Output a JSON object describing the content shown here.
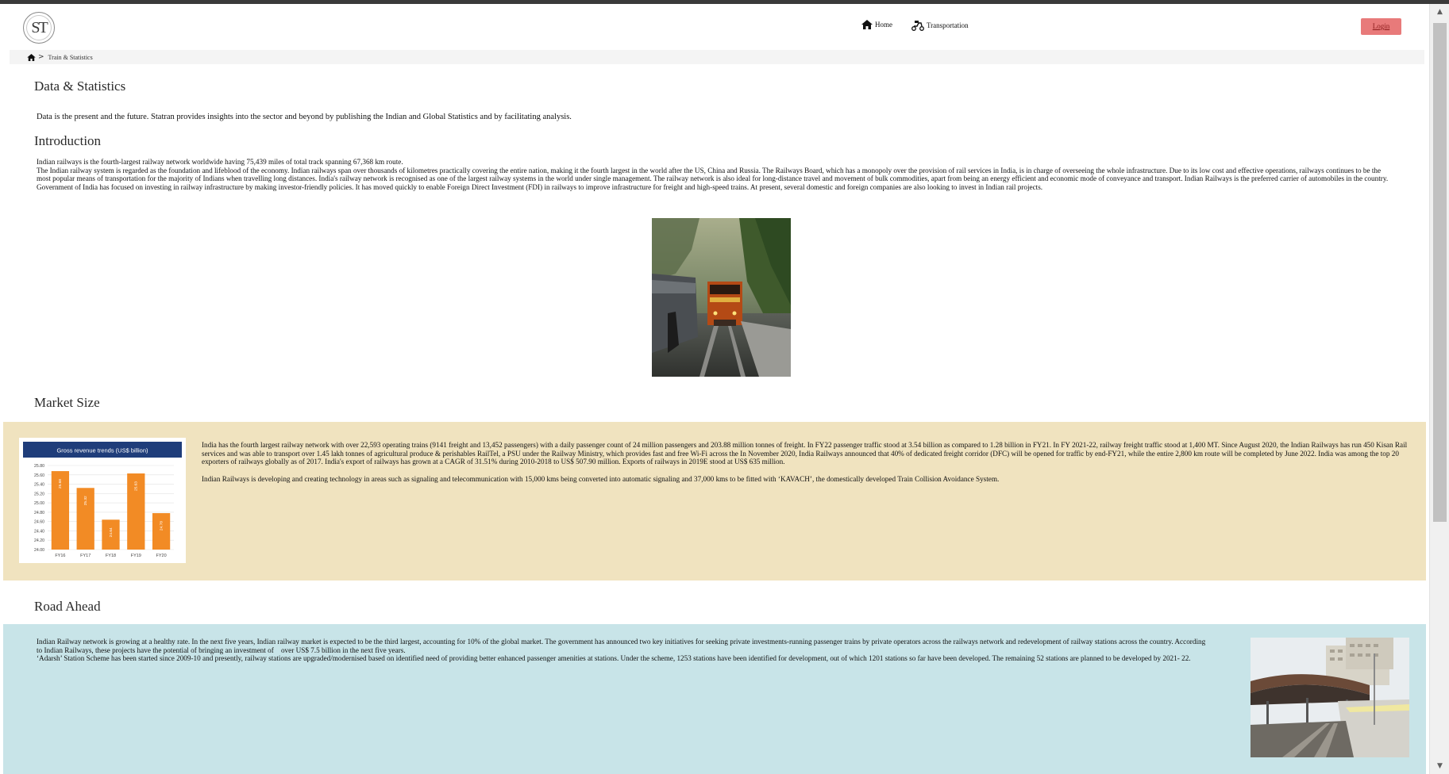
{
  "header": {
    "logo_text": "ST",
    "nav": [
      {
        "label": "Home",
        "icon": "home-icon"
      },
      {
        "label": "Transportation",
        "icon": "scooter-icon"
      }
    ],
    "login_label": "Login"
  },
  "breadcrumb": {
    "home_icon": "home-icon",
    "separator": ">",
    "current": "Train & Statistics"
  },
  "sections": {
    "data_stats": {
      "title": "Data & Statistics",
      "text": "Data is the present and the future. Statran provides insights into the sector and beyond by publishing the Indian and Global Statistics and by facilitating analysis."
    },
    "introduction": {
      "title": "Introduction",
      "line1": "Indian railways is the fourth-largest railway network worldwide having 75,439 miles of total track spanning 67,368 km route.",
      "line2": "The Indian railway system is regarded as the foundation and lifeblood of the economy. Indian railways span over thousands of kilometres practically covering the entire nation, making it the fourth largest in the world after the US, China and Russia. The Railways Board, which has a monopoly over the provision of rail services in India, is in charge of overseeing the whole infrastructure. Due to its low cost and effective operations, railways continues to be the most popular means of transportation for the majority of Indians when travelling long distances. India's railway network is recognised as one of the largest railway systems in the world under single management. The railway network is also ideal for long-distance travel and movement of bulk commodities, apart from being an energy efficient and economic mode of conveyance and transport. Indian Railways is the preferred carrier of automobiles in the country. Government of India has focused on investing in railway infrastructure by making investor-friendly policies. It has moved quickly to enable Foreign Direct Investment (FDI) in railways to improve infrastructure for freight and high-speed trains. At present, several domestic and foreign companies are also looking to invest in Indian rail projects."
    },
    "market_size": {
      "title": "Market Size",
      "para1": "India has the fourth largest railway network with over 22,593 operating trains (9141 freight and 13,452 passengers) with a daily passenger count of 24 million passengers and 203.88 million tonnes of freight. In FY22 passenger traffic stood at 3.54 billion as compared to 1.28 billion in FY21. In FY 2021-22, railway freight traffic stood at 1,400 MT. Since August 2020, the Indian Railways has run 450 Kisan Rail services and was able to transport over 1.45 lakh tonnes of agricultural produce & perishables RailTel, a PSU under the Railway Ministry, which provides fast and free Wi-Fi across the In November 2020, India Railways announced that 40% of dedicated freight corridor (DFC) will be opened for traffic by end-FY21, while the entire 2,800 km route will be completed by June 2022. India was among the top 20 exporters of railways globally as of 2017. India's export of railways has grown at a CAGR of 31.51% during 2010-2018 to US$ 507.90 million. Exports of railways in 2019E stood at US$ 635 million.",
      "para2": "Indian Railways is developing and creating technology in areas such as signaling and telecommunication with 15,000 kms being converted into automatic signaling and 37,000 kms to be fitted with ‘KAVACH’, the domestically developed Train Collision Avoidance System."
    },
    "road_ahead": {
      "title": "Road Ahead",
      "para1": "Indian Railway network is growing at a healthy rate. In the next five years, Indian railway market is expected to be the third largest, accounting for 10% of the global market. The government has announced two key initiatives for seeking private investments-running passenger trains by private operators across the railways network and redevelopment of railway stations across the country. According to Indian Railways, these projects have the potential of bringing an investment of    over US$ 7.5 billion in the next five years.",
      "para2": "‘Adarsh’ Station Scheme has been started since 2009-10 and presently, railway stations are upgraded/modernised based on identified need of providing better enhanced passenger amenities at stations. Under the scheme, 1253 stations have been identified for development, out of which 1201 stations so far have been developed. The remaining 52 stations are planned to be developed by 2021- 22."
    }
  },
  "chart_data": {
    "type": "bar",
    "title": "Gross revenue trends (US$ billion)",
    "categories": [
      "FY16",
      "FY17",
      "FY18",
      "FY19",
      "FY20"
    ],
    "values": [
      25.68,
      25.32,
      24.64,
      25.63,
      24.78
    ],
    "ylim": [
      24.0,
      25.8
    ],
    "yticks": [
      "25.80",
      "25.60",
      "25.40",
      "25.20",
      "25.00",
      "24.80",
      "24.60",
      "24.40",
      "24.20",
      "24.00"
    ],
    "grid": true,
    "bar_color": "#f28b25",
    "title_bg": "#1f3d7a"
  },
  "colors": {
    "market_bg": "#f0e3bf",
    "road_bg": "#c8e4e8",
    "login_bg": "#e87a7a"
  }
}
